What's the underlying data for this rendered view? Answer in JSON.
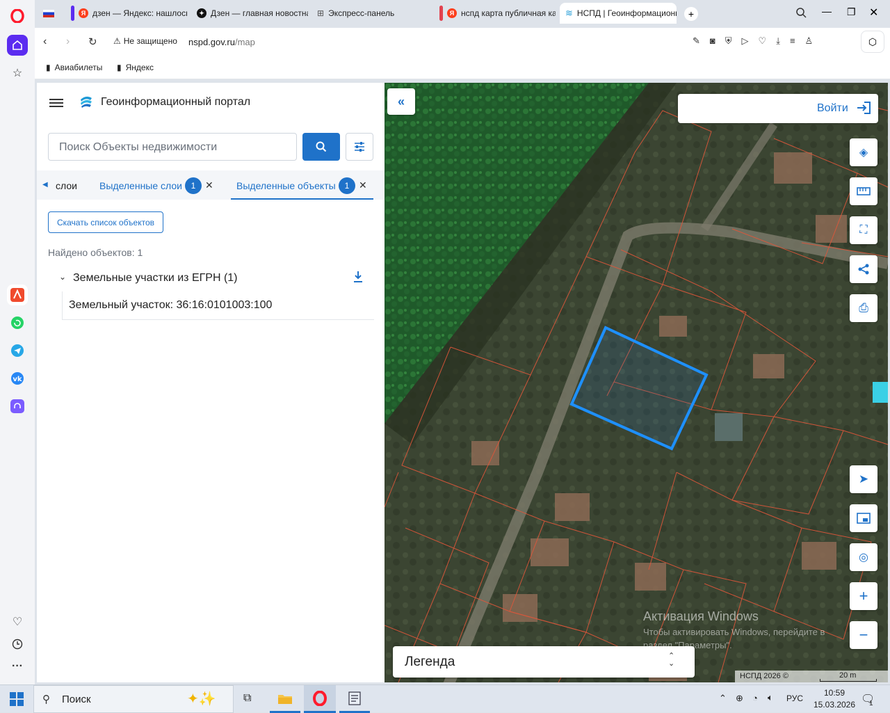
{
  "browser": {
    "tabs": [
      {
        "label": "",
        "favicon": "russia-flag-icon"
      },
      {
        "label": "дзен — Яндекс: нашлось",
        "favicon": "yandex-icon"
      },
      {
        "label": "Дзен — главная новостная",
        "favicon": "dzen-icon"
      },
      {
        "label": "Экспресс-панель",
        "favicon": "grid-icon"
      },
      {
        "label": "нспд карта публичная кадастровая",
        "favicon": "yandex-icon"
      },
      {
        "label": "НСПД | Геоинформационный",
        "favicon": "nspd-icon"
      }
    ],
    "security_label": "Не защищено",
    "url_host": "nspd.gov.ru",
    "url_path": "/map",
    "bookmarks": [
      "Авиабилеты",
      "Яндекс"
    ]
  },
  "portal": {
    "title": "Геоинформационный портал",
    "search_placeholder": "Поиск Объекты недвижимости",
    "tabs": {
      "layers": "слои",
      "selected_layers": "Выделенные слои",
      "selected_layers_count": "1",
      "selected_objects": "Выделенные объекты",
      "selected_objects_count": "1"
    },
    "download_list": "Скачать список объектов",
    "found": "Найдено объектов: 1",
    "group_title": "Земельные участки из ЕГРН (1)",
    "item": "Земельный участок: 36:16:0101003:100"
  },
  "map": {
    "login": "Войти",
    "legend": "Легенда",
    "copyright": "НСПД 2026 ©",
    "scale": "20 m",
    "watermark_title": "Активация Windows",
    "watermark_text1": "Чтобы активировать Windows, перейдите в",
    "watermark_text2": "раздел \"Параметры\"."
  },
  "taskbar": {
    "search": "Поиск",
    "lang": "РУС",
    "time": "10:59",
    "date": "15.03.2026",
    "notif_count": "1"
  },
  "colors": {
    "accent": "#1f72c9",
    "selected_parcel": "#1e90ff",
    "parcel_border": "#e0563a",
    "opera_red": "#ff1b2d"
  }
}
